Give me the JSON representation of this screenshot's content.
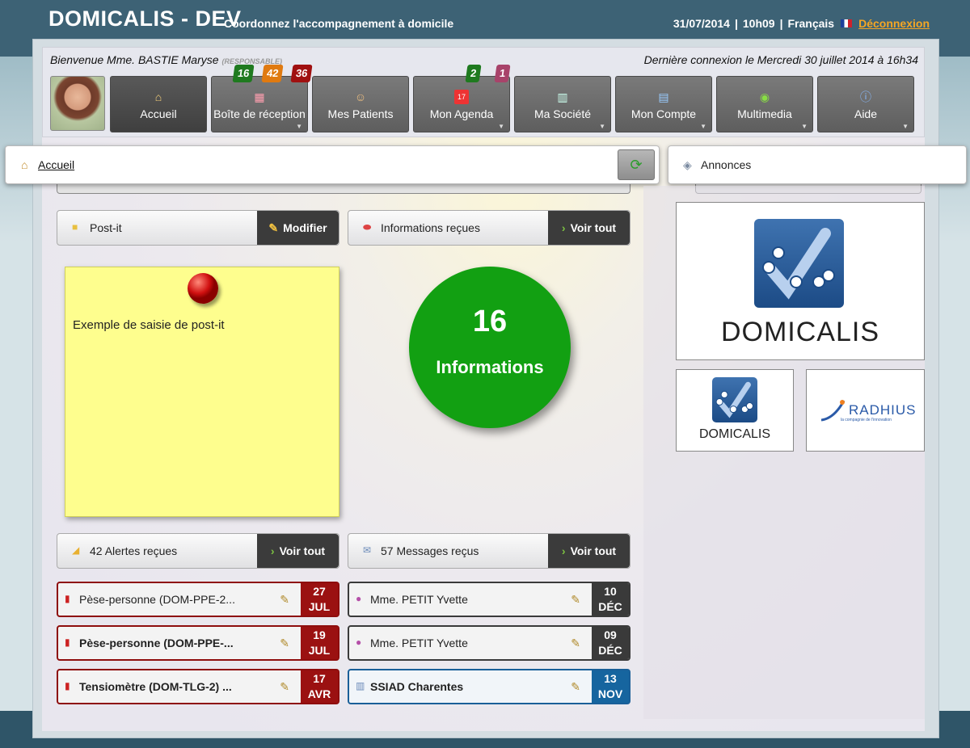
{
  "header": {
    "title": "DOMICALIS - DEV",
    "tagline": "Coordonnez l'accompagnement à domicile",
    "date": "31/07/2014",
    "time": "10h09",
    "language": "Français",
    "logout": "Déconnexion",
    "separator": "|"
  },
  "welcome": {
    "text": "Bienvenue Mme. BASTIE Maryse",
    "role": "(RESPONSABLE)",
    "last_connection": "Dernière connexion le Mercredi 30 juillet 2014 à 16h34"
  },
  "nav": [
    {
      "label": "Accueil",
      "icon": "home-icon"
    },
    {
      "label": "Boîte de réception",
      "icon": "grid-icon",
      "badges": [
        "16",
        "42",
        "36"
      ]
    },
    {
      "label": "Mes Patients",
      "icon": "patients-icon"
    },
    {
      "label": "Mon Agenda",
      "icon": "calendar-icon",
      "badges": [
        "2",
        "1"
      ]
    },
    {
      "label": "Ma Société",
      "icon": "building-icon"
    },
    {
      "label": "Mon Compte",
      "icon": "id-card-icon"
    },
    {
      "label": "Multimedia",
      "icon": "globe-icon"
    },
    {
      "label": "Aide",
      "icon": "info-icon"
    }
  ],
  "breadcrumb": {
    "label": "Accueil"
  },
  "announcements": {
    "label": "Annonces"
  },
  "postit": {
    "header": "Post-it",
    "action": "Modifier",
    "text": "Exemple de saisie de post-it"
  },
  "infos": {
    "header": "Informations reçues",
    "action": "Voir tout",
    "count": "16",
    "label": "Informations"
  },
  "alerts": {
    "header": "42 Alertes reçues",
    "action": "Voir tout",
    "items": [
      {
        "title": "Pèse-personne (DOM-PPE-2...",
        "day": "27",
        "month": "JUL",
        "bold": false
      },
      {
        "title": "Pèse-personne (DOM-PPE-...",
        "day": "19",
        "month": "JUL",
        "bold": true
      },
      {
        "title": "Tensiomètre (DOM-TLG-2) ...",
        "day": "17",
        "month": "AVR",
        "bold": true
      }
    ]
  },
  "messages": {
    "header": "57 Messages reçus",
    "action": "Voir tout",
    "items": [
      {
        "title": "Mme. PETIT Yvette",
        "day": "10",
        "month": "DÉC",
        "bold": false
      },
      {
        "title": "Mme. PETIT Yvette",
        "day": "09",
        "month": "DÉC",
        "bold": false
      },
      {
        "title": "SSIAD Charentes",
        "day": "13",
        "month": "NOV",
        "bold": true
      }
    ]
  },
  "logos": {
    "main": "DOMICALIS",
    "small": "DOMICALIS",
    "partner": "RADHIUS",
    "partner_sub": "la compagnie de l'innovation"
  },
  "colors": {
    "header_bg": "#3d6275",
    "logout": "#f5a623",
    "alert_red": "#9b1111",
    "info_green": "#12a012",
    "dark": "#3a3a3a",
    "blue": "#16659f",
    "badge_green": "#1f7a1f",
    "badge_orange": "#e07a10",
    "badge_red": "#a01010",
    "badge_purple": "#a8436a"
  }
}
